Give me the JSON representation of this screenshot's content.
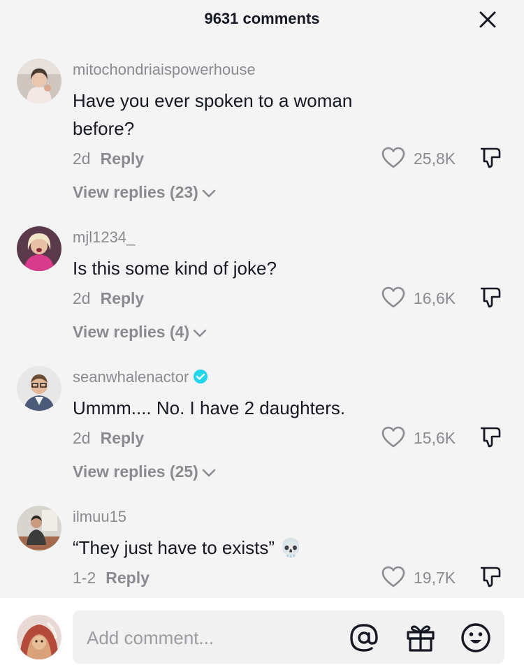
{
  "header": {
    "title": "9631 comments"
  },
  "comments": [
    {
      "username": "mitochondriaispowerhouse",
      "text": "Have you ever spoken to a woman before?",
      "age": "2d",
      "reply_label": "Reply",
      "likes": "25,8K",
      "view_replies": "View replies (23)",
      "verified": false
    },
    {
      "username": "mjl1234_",
      "text": "Is this some kind of joke?",
      "age": "2d",
      "reply_label": "Reply",
      "likes": "16,6K",
      "view_replies": "View replies (4)",
      "verified": false
    },
    {
      "username": "seanwhalenactor",
      "text": "Ummm.... No. I have 2 daughters.",
      "age": "2d",
      "reply_label": "Reply",
      "likes": "15,6K",
      "view_replies": "View replies (25)",
      "verified": true
    },
    {
      "username": "ilmuu15",
      "text": "“They just have to exists” 💀",
      "age": "1-2",
      "reply_label": "Reply",
      "likes": "19,7K",
      "verified": false
    }
  ],
  "composer": {
    "placeholder": "Add comment..."
  },
  "colors": {
    "background": "#f4f4f4",
    "verified": "#20d5ec",
    "muted_text": "#8a8b91"
  }
}
